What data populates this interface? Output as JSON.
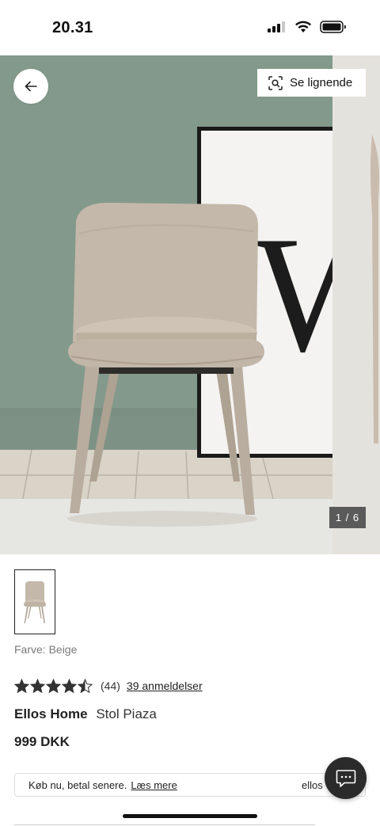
{
  "status_bar": {
    "time": "20.31",
    "icons": [
      "signal-icon",
      "wifi-icon",
      "battery-icon"
    ]
  },
  "gallery": {
    "back_icon": "arrow-left-icon",
    "similar_label": "Se lignende",
    "similar_icon": "visual-search-icon",
    "page_indicator": "1 / 6",
    "poster_letter": "W"
  },
  "product": {
    "color_label": "Farve: Beige",
    "rating": 4.5,
    "rating_max": 5,
    "rating_count": "(44)",
    "reviews_link": "39 anmeldelser",
    "brand": "Ellos Home",
    "name": "Stol Piaza",
    "price": "999 DKK"
  },
  "pay_later": {
    "text": "Køb nu, betal senere.",
    "link": "Læs mere",
    "provider": "ellos"
  },
  "chat": {
    "icon": "chat-bubble-icon"
  },
  "colors": {
    "wall": "#82998b",
    "chair": "#c2b6a8",
    "floor": "#ddd8d0",
    "dark": "#2b2b2b"
  }
}
